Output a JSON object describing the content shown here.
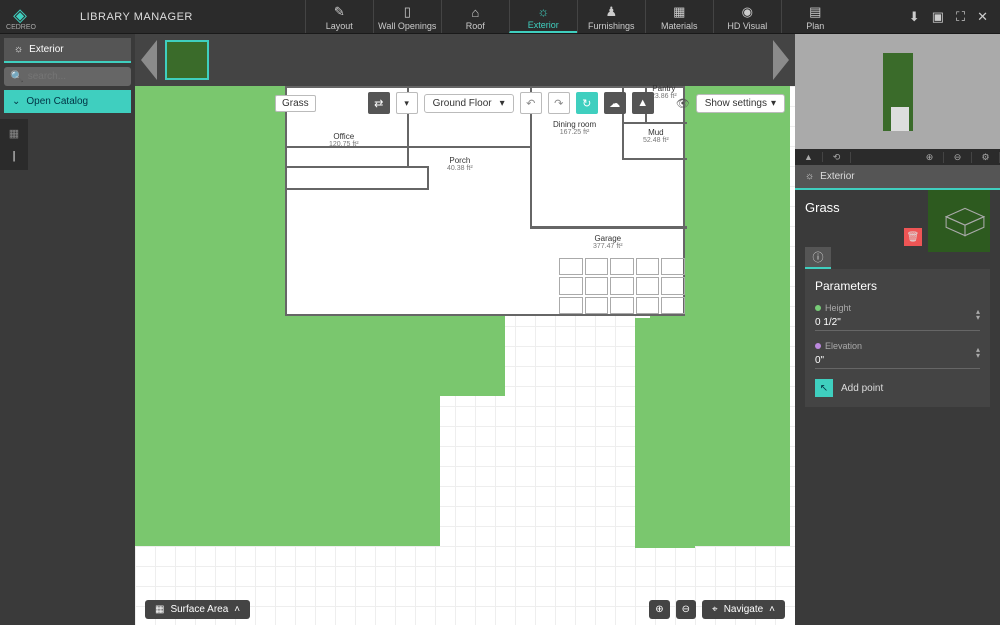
{
  "app": {
    "brand": "CEDREO",
    "title": "LIBRARY MANAGER"
  },
  "modes": {
    "layout": "Layout",
    "wall": "Wall Openings",
    "roof": "Roof",
    "exterior": "Exterior",
    "furnish": "Furnishings",
    "materials": "Materials",
    "hd": "HD Visual",
    "plan": "Plan"
  },
  "left": {
    "tab": "Exterior",
    "search_ph": "search...",
    "open": "Open Catalog"
  },
  "canvas": {
    "grass_label": "Grass",
    "floor": "Ground Floor",
    "show": "Show settings",
    "surface": "Surface Area",
    "navigate": "Navigate",
    "rooms": {
      "office": {
        "name": "Office",
        "sq": "120.75 ft²"
      },
      "porch": {
        "name": "Porch",
        "sq": "40.38 ft²"
      },
      "dining": {
        "name": "Dining room",
        "sq": "167.25 ft²"
      },
      "pantry": {
        "name": "Pantry",
        "sq": "23.86 ft²"
      },
      "mud": {
        "name": "Mud",
        "sq": "52.48 ft²"
      },
      "garage": {
        "name": "Garage",
        "sq": "377.47 ft²"
      }
    }
  },
  "panel": {
    "tab": "Exterior",
    "title": "Grass",
    "params_title": "Parameters",
    "height": {
      "label": "Height",
      "value": "0 1/2\""
    },
    "elev": {
      "label": "Elevation",
      "value": "0\""
    },
    "add": "Add point"
  }
}
